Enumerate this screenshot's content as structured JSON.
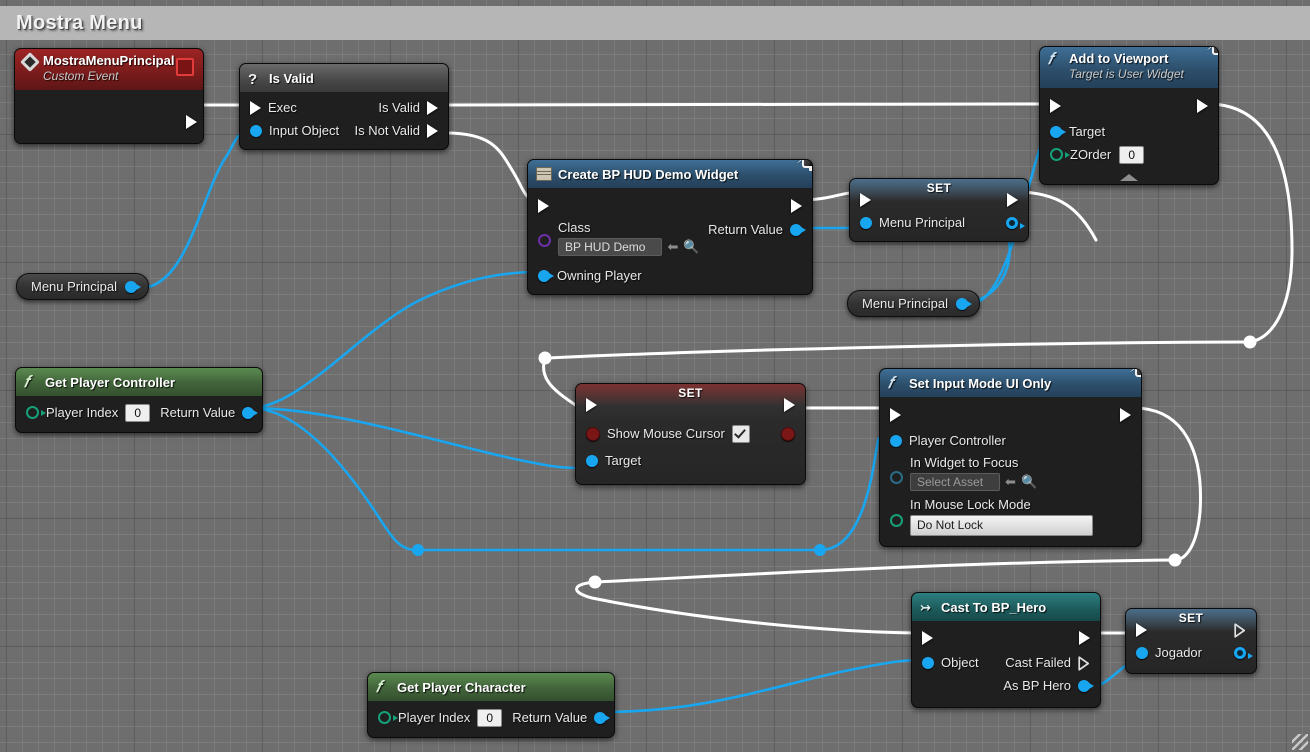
{
  "window": {
    "title": "Mostra Menu"
  },
  "colors": {
    "exec_wire": "#ffffff",
    "object_wire": "#19a6f0",
    "event_header": "#7c1c1c",
    "function_header": "#2d4f6b",
    "pure_function_header": "#41633a",
    "cast_header": "#1e5c5d",
    "canvas": "#6e6e6e"
  },
  "nodes": {
    "custom_event": {
      "title": "MostraMenuPrincipal",
      "subtitle": "Custom Event",
      "icon": "event-diamond-icon",
      "outputs": [
        {
          "label": "",
          "type": "exec"
        }
      ]
    },
    "is_valid": {
      "title": "Is Valid",
      "icon": "question-mark-icon",
      "inputs": [
        {
          "label": "Exec",
          "type": "exec"
        },
        {
          "label": "Input Object",
          "type": "object"
        }
      ],
      "outputs": [
        {
          "label": "Is Valid",
          "type": "exec"
        },
        {
          "label": "Is Not Valid",
          "type": "exec"
        }
      ]
    },
    "create_widget": {
      "title": "Create BP HUD Demo Widget",
      "icon": "widget-icon",
      "badge": "client-only-icon",
      "inputs": [
        {
          "label": "Class",
          "type": "class",
          "value": "BP HUD Demo"
        },
        {
          "label": "Owning Player",
          "type": "object"
        }
      ],
      "outputs": [
        {
          "label": "Return Value",
          "type": "object"
        }
      ]
    },
    "set_menu_principal": {
      "title": "SET",
      "inputs": [
        {
          "label": "Menu Principal",
          "type": "object"
        }
      ],
      "outputs": [
        {
          "label": "",
          "type": "object"
        }
      ]
    },
    "add_to_viewport": {
      "title": "Add to Viewport",
      "subtitle": "Target is User Widget",
      "icon": "function-icon",
      "badge": "client-only-icon",
      "inputs": [
        {
          "label": "Target",
          "type": "object"
        },
        {
          "label": "ZOrder",
          "type": "int",
          "value": "0"
        }
      ],
      "collapse": "collapse-arrow-icon"
    },
    "get_menu_principal_1": {
      "label": "Menu Principal"
    },
    "get_menu_principal_2": {
      "label": "Menu Principal"
    },
    "get_player_controller": {
      "title": "Get Player Controller",
      "icon": "function-icon",
      "inputs": [
        {
          "label": "Player Index",
          "type": "int",
          "value": "0"
        }
      ],
      "outputs": [
        {
          "label": "Return Value",
          "type": "object"
        }
      ]
    },
    "set_show_mouse_cursor": {
      "title": "SET",
      "inputs": [
        {
          "label": "Show Mouse Cursor",
          "type": "bool",
          "value": true
        },
        {
          "label": "Target",
          "type": "object"
        }
      ],
      "outputs": [
        {
          "label": "",
          "type": "bool"
        }
      ]
    },
    "set_input_mode": {
      "title": "Set Input Mode UI Only",
      "icon": "function-icon",
      "badge": "client-only-icon",
      "inputs": [
        {
          "label": "Player Controller",
          "type": "object"
        },
        {
          "label": "In Widget to Focus",
          "type": "object",
          "value": "Select Asset"
        },
        {
          "label": "In Mouse Lock Mode",
          "type": "enum",
          "value": "Do Not Lock"
        }
      ]
    },
    "cast_to_bp_hero": {
      "title": "Cast To BP_Hero",
      "icon": "cast-icon",
      "inputs": [
        {
          "label": "Object",
          "type": "object"
        }
      ],
      "outputs": [
        {
          "label": "Cast Failed",
          "type": "exec"
        },
        {
          "label": "As BP Hero",
          "type": "object"
        }
      ]
    },
    "set_jogador": {
      "title": "SET",
      "inputs": [
        {
          "label": "Jogador",
          "type": "object"
        }
      ],
      "outputs": [
        {
          "label": "",
          "type": "object"
        }
      ]
    },
    "get_player_character": {
      "title": "Get Player Character",
      "icon": "function-icon",
      "inputs": [
        {
          "label": "Player Index",
          "type": "int",
          "value": "0"
        }
      ],
      "outputs": [
        {
          "label": "Return Value",
          "type": "object"
        }
      ]
    }
  }
}
